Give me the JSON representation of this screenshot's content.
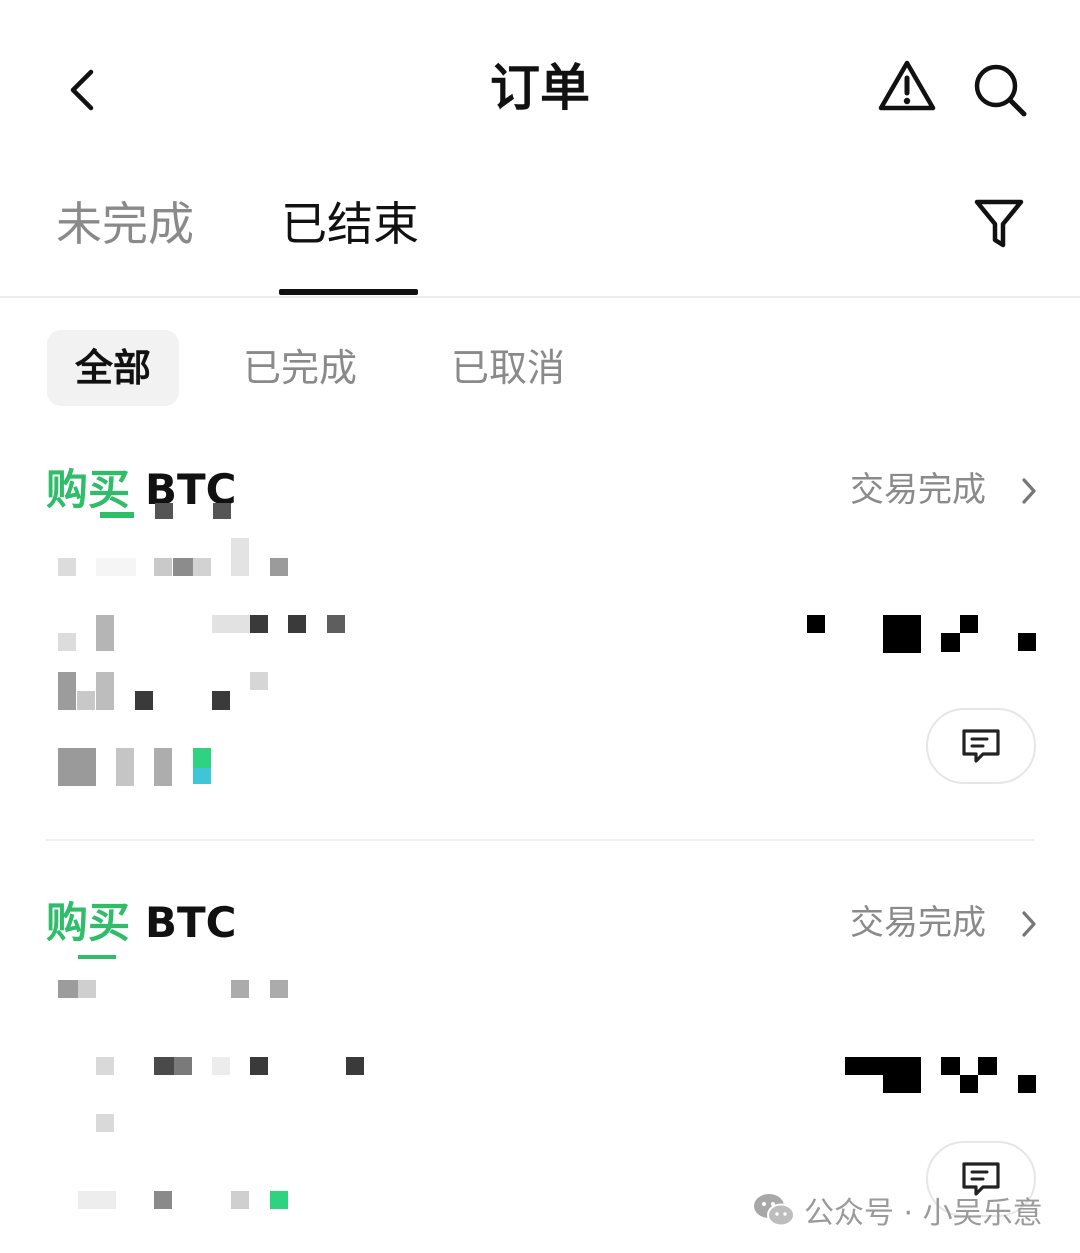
{
  "header": {
    "title": "订单",
    "icons": [
      "back-icon",
      "warning-icon",
      "search-icon"
    ]
  },
  "tabs": [
    {
      "label": "未完成",
      "active": false
    },
    {
      "label": "已结束",
      "active": true
    }
  ],
  "filter_icon": "filter-icon",
  "subtabs": [
    {
      "label": "全部",
      "active": true
    },
    {
      "label": "已完成",
      "active": false
    },
    {
      "label": "已取消",
      "active": false
    }
  ],
  "orders": [
    {
      "side": "购买",
      "asset": "BTC",
      "status": "交易完成"
    },
    {
      "side": "购买",
      "asset": "BTC",
      "status": "交易完成"
    }
  ],
  "watermark": {
    "text": "公众号 · 小吴乐意",
    "icon": "wechat-icon"
  },
  "colors": {
    "buy": "#2fbd6a",
    "text": "#111111",
    "muted": "#8a8a8a"
  }
}
